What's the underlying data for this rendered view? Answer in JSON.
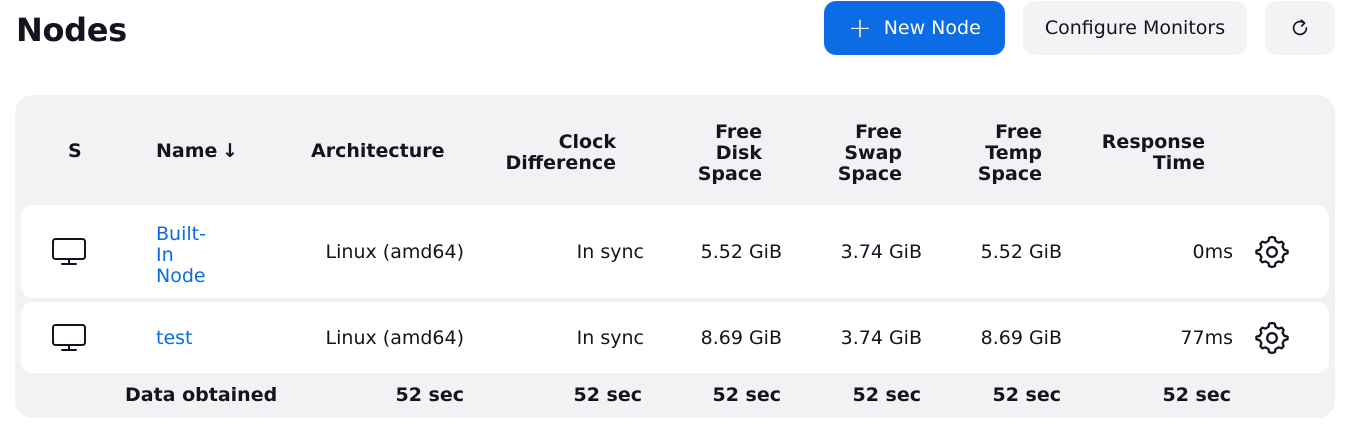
{
  "page": {
    "title": "Nodes",
    "new_node_label": "New Node",
    "configure_monitors_label": "Configure Monitors"
  },
  "icons": {
    "plus": "plus-icon",
    "refresh": "refresh-icon",
    "computer": "computer-icon",
    "gear": "gear-icon"
  },
  "colors": {
    "accent": "#0b6ce6",
    "panel_bg": "#f2f2f5",
    "button_bg": "#f3f3f6"
  },
  "table": {
    "headers": {
      "status": "S",
      "name": "Name",
      "name_sort": "↓",
      "architecture": "Architecture",
      "clock_1": "Clock",
      "clock_2": "Difference",
      "disk_1": "Free",
      "disk_2": "Disk",
      "disk_3": "Space",
      "swap_1": "Free",
      "swap_2": "Swap",
      "swap_3": "Space",
      "temp_1": "Free",
      "temp_2": "Temp",
      "temp_3": "Space",
      "response_1": "Response",
      "response_2": "Time"
    },
    "rows": [
      {
        "name_lines": [
          "Built-",
          "In",
          "Node"
        ],
        "architecture": "Linux (amd64)",
        "clock": "In sync",
        "disk": "5.52 GiB",
        "swap": "3.74 GiB",
        "temp": "5.52 GiB",
        "response": "0ms"
      },
      {
        "name": "test",
        "architecture": "Linux (amd64)",
        "clock": "In sync",
        "disk": "8.69 GiB",
        "swap": "3.74 GiB",
        "temp": "8.69 GiB",
        "response": "77ms"
      }
    ],
    "footer": {
      "label": "Data obtained",
      "architecture": "52 sec",
      "clock": "52 sec",
      "disk": "52 sec",
      "swap": "52 sec",
      "temp": "52 sec",
      "response": "52 sec"
    }
  }
}
